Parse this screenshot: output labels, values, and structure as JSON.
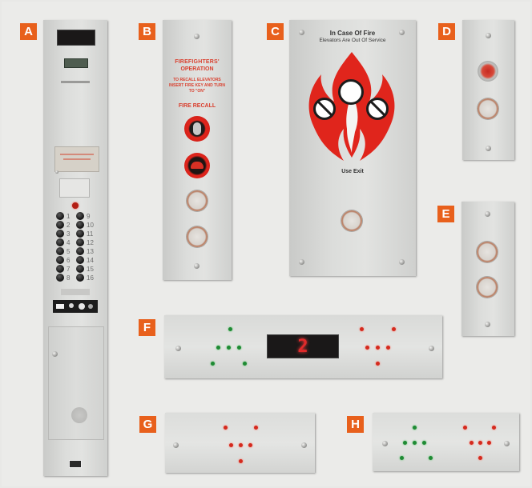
{
  "panel_labels": [
    "A",
    "B",
    "C",
    "D",
    "E",
    "F",
    "G",
    "H"
  ],
  "panel_b": {
    "title_line1": "FIREFIGHTERS'",
    "title_line2": "OPERATION",
    "instructions": "TO RECALL ELEVATORS INSERT FIRE KEY AND TURN TO \"ON\"",
    "recall_label": "FIRE RECALL"
  },
  "panel_c": {
    "line1": "In Case Of Fire",
    "line2": "Elevators Are Out Of Service",
    "exit_text": "Use Exit"
  },
  "panel_f": {
    "floor_display": "2"
  },
  "keypad": {
    "left_column_numbers": [
      "1",
      "2",
      "3",
      "4",
      "5",
      "6",
      "7",
      "8"
    ],
    "right_column_numbers": [
      "9",
      "10",
      "11",
      "12",
      "13",
      "14",
      "15",
      "16"
    ]
  },
  "colors": {
    "label_orange": "#e8601c",
    "panel_steel": "#dcdddb",
    "fire_red": "#e0251c",
    "led_red": "#d42a1e",
    "led_green": "#1f8a34"
  }
}
